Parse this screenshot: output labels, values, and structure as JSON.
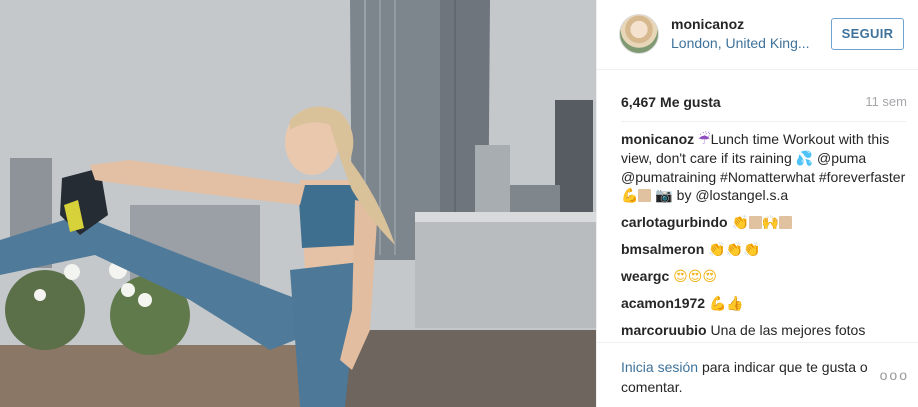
{
  "post": {
    "author": {
      "username": "monicanoz",
      "location": "London, United King...",
      "follow_label": "SEGUIR"
    },
    "likes": {
      "count": "6,467",
      "label": "Me gusta"
    },
    "time_ago": "11 sem",
    "caption": {
      "username": "monicanoz",
      "text_1": "Lunch time Workout with this view, don't care if its raining",
      "text_2": "@puma @pumatraining #Nomatterwhat #foreverfaster",
      "text_3": "by @lostangel.s.a"
    },
    "comments": [
      {
        "username": "carlotagurbindo"
      },
      {
        "username": "bmsalmeron"
      },
      {
        "username": "weargc"
      },
      {
        "username": "acamon1972"
      },
      {
        "username": "marcoruubio",
        "text": "Una de las mejores fotos"
      }
    ],
    "login_prompt": {
      "link_text": "Inicia sesión",
      "rest_text": "para indicar que te gusta o comentar."
    },
    "more_options": "ooo"
  },
  "icons": {
    "umbrella": "umbrella-with-rain-icon",
    "droplets": "sweat-droplets-icon",
    "muscle": "flexed-biceps-icon",
    "camera": "camera-icon",
    "clap": "clapping-hands-icon",
    "raised_hands": "raised-hands-icon",
    "heart_eyes": "heart-eyes-icon"
  },
  "colors": {
    "link": "#3f729b",
    "text": "#262626",
    "muted": "#a5a7aa",
    "border": "#efefef"
  }
}
